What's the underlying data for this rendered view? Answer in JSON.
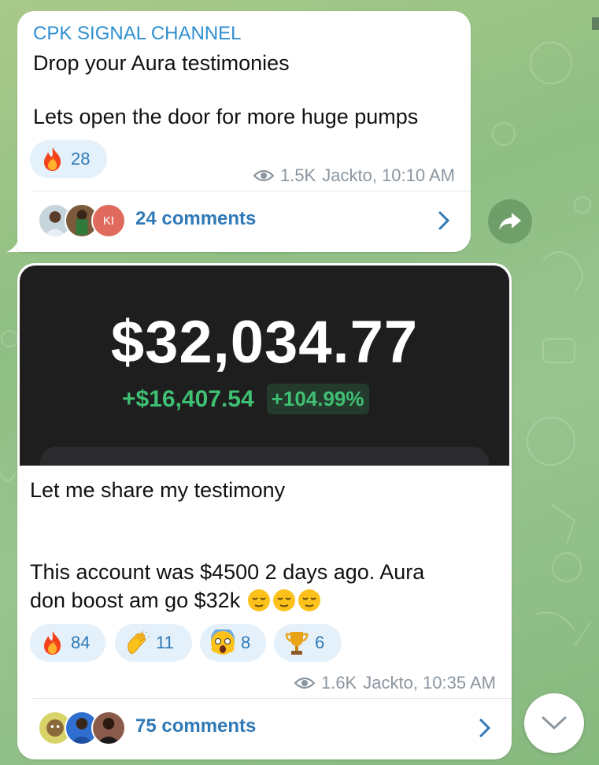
{
  "post1": {
    "channel": "CPK SIGNAL CHANNEL",
    "line1": "Drop your Aura testimonies",
    "line2": "Lets open the door for more huge pumps",
    "reactions": [
      {
        "icon": "fire-icon",
        "count": "28"
      }
    ],
    "views": "1.5K",
    "author_time": "Jackto, 10:10 AM",
    "avatar_initials": "KI",
    "comments": "24 comments"
  },
  "post2": {
    "balance": "$32,034.77",
    "gain": "+$16,407.54",
    "gain_pct": "+104.99%",
    "line1": "Let me share my testimony",
    "line2": "This account was $4500 2 days ago. Aura",
    "line3": "don boost am go $32k",
    "reactions": [
      {
        "icon": "fire-icon",
        "count": "84"
      },
      {
        "icon": "clapping-hands-icon",
        "count": "11"
      },
      {
        "icon": "screaming-face-icon",
        "count": "8"
      },
      {
        "icon": "trophy-icon",
        "count": "6"
      }
    ],
    "views": "1.6K",
    "author_time": "Jackto, 10:35 AM",
    "comments": "75 comments"
  },
  "colors": {
    "accent": "#2f79b7",
    "channel_name": "#2f8fd0",
    "gain": "#3fbf72",
    "media_bg": "#1e1e1f"
  }
}
